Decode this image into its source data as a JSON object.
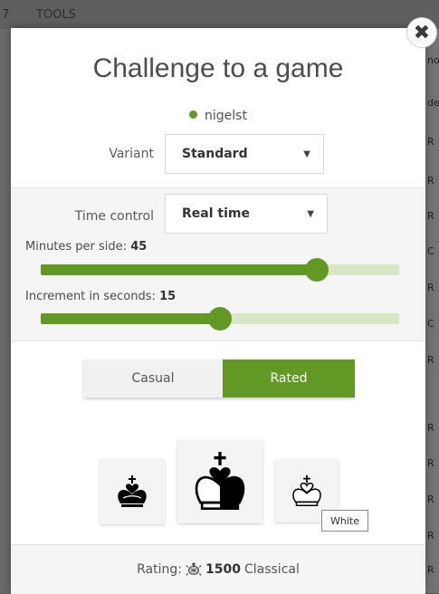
{
  "background": {
    "menu_fragment": "7",
    "menu_tools": "TOOLS",
    "right_column_cells": [
      "no",
      "de",
      "R",
      "R",
      "R",
      "C",
      "R",
      "C",
      "R",
      "R",
      "R",
      "R",
      "R",
      "R"
    ]
  },
  "modal": {
    "title": "Challenge to a game",
    "opponent": {
      "name": "nigelst",
      "status_color": "#629924"
    },
    "variant": {
      "label": "Variant",
      "value": "Standard"
    },
    "time_control": {
      "label": "Time control",
      "value": "Real time"
    },
    "minutes": {
      "label": "Minutes per side:",
      "value": "45",
      "level": 0.77
    },
    "increment": {
      "label": "Increment in seconds:",
      "value": "15",
      "level": 0.5
    },
    "mode": {
      "casual": "Casual",
      "rated": "Rated",
      "selected": "Rated"
    },
    "colors": [
      {
        "name": "black",
        "icon": "black-king-icon"
      },
      {
        "name": "random",
        "icon": "random-king-icon"
      },
      {
        "name": "white",
        "icon": "white-king-icon"
      }
    ],
    "tooltip": "White",
    "rating": {
      "prefix": "Rating:",
      "value": "1500",
      "category": "Classical",
      "icon": "turtle-icon"
    }
  },
  "accent_color": "#629924"
}
